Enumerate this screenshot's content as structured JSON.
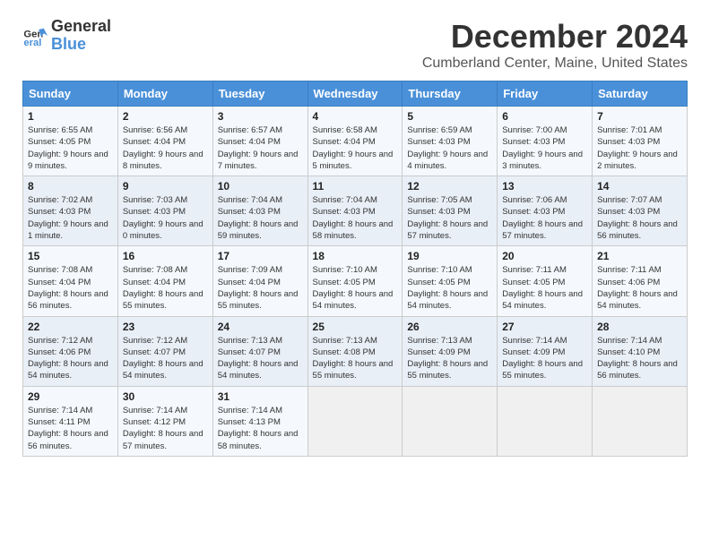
{
  "logo": {
    "line1": "General",
    "line2": "Blue"
  },
  "title": "December 2024",
  "subtitle": "Cumberland Center, Maine, United States",
  "header": {
    "days": [
      "Sunday",
      "Monday",
      "Tuesday",
      "Wednesday",
      "Thursday",
      "Friday",
      "Saturday"
    ]
  },
  "weeks": [
    [
      {
        "day": "1",
        "info": "Sunrise: 6:55 AM\nSunset: 4:05 PM\nDaylight: 9 hours and 9 minutes."
      },
      {
        "day": "2",
        "info": "Sunrise: 6:56 AM\nSunset: 4:04 PM\nDaylight: 9 hours and 8 minutes."
      },
      {
        "day": "3",
        "info": "Sunrise: 6:57 AM\nSunset: 4:04 PM\nDaylight: 9 hours and 7 minutes."
      },
      {
        "day": "4",
        "info": "Sunrise: 6:58 AM\nSunset: 4:04 PM\nDaylight: 9 hours and 5 minutes."
      },
      {
        "day": "5",
        "info": "Sunrise: 6:59 AM\nSunset: 4:03 PM\nDaylight: 9 hours and 4 minutes."
      },
      {
        "day": "6",
        "info": "Sunrise: 7:00 AM\nSunset: 4:03 PM\nDaylight: 9 hours and 3 minutes."
      },
      {
        "day": "7",
        "info": "Sunrise: 7:01 AM\nSunset: 4:03 PM\nDaylight: 9 hours and 2 minutes."
      }
    ],
    [
      {
        "day": "8",
        "info": "Sunrise: 7:02 AM\nSunset: 4:03 PM\nDaylight: 9 hours and 1 minute."
      },
      {
        "day": "9",
        "info": "Sunrise: 7:03 AM\nSunset: 4:03 PM\nDaylight: 9 hours and 0 minutes."
      },
      {
        "day": "10",
        "info": "Sunrise: 7:04 AM\nSunset: 4:03 PM\nDaylight: 8 hours and 59 minutes."
      },
      {
        "day": "11",
        "info": "Sunrise: 7:04 AM\nSunset: 4:03 PM\nDaylight: 8 hours and 58 minutes."
      },
      {
        "day": "12",
        "info": "Sunrise: 7:05 AM\nSunset: 4:03 PM\nDaylight: 8 hours and 57 minutes."
      },
      {
        "day": "13",
        "info": "Sunrise: 7:06 AM\nSunset: 4:03 PM\nDaylight: 8 hours and 57 minutes."
      },
      {
        "day": "14",
        "info": "Sunrise: 7:07 AM\nSunset: 4:03 PM\nDaylight: 8 hours and 56 minutes."
      }
    ],
    [
      {
        "day": "15",
        "info": "Sunrise: 7:08 AM\nSunset: 4:04 PM\nDaylight: 8 hours and 56 minutes."
      },
      {
        "day": "16",
        "info": "Sunrise: 7:08 AM\nSunset: 4:04 PM\nDaylight: 8 hours and 55 minutes."
      },
      {
        "day": "17",
        "info": "Sunrise: 7:09 AM\nSunset: 4:04 PM\nDaylight: 8 hours and 55 minutes."
      },
      {
        "day": "18",
        "info": "Sunrise: 7:10 AM\nSunset: 4:05 PM\nDaylight: 8 hours and 54 minutes."
      },
      {
        "day": "19",
        "info": "Sunrise: 7:10 AM\nSunset: 4:05 PM\nDaylight: 8 hours and 54 minutes."
      },
      {
        "day": "20",
        "info": "Sunrise: 7:11 AM\nSunset: 4:05 PM\nDaylight: 8 hours and 54 minutes."
      },
      {
        "day": "21",
        "info": "Sunrise: 7:11 AM\nSunset: 4:06 PM\nDaylight: 8 hours and 54 minutes."
      }
    ],
    [
      {
        "day": "22",
        "info": "Sunrise: 7:12 AM\nSunset: 4:06 PM\nDaylight: 8 hours and 54 minutes."
      },
      {
        "day": "23",
        "info": "Sunrise: 7:12 AM\nSunset: 4:07 PM\nDaylight: 8 hours and 54 minutes."
      },
      {
        "day": "24",
        "info": "Sunrise: 7:13 AM\nSunset: 4:07 PM\nDaylight: 8 hours and 54 minutes."
      },
      {
        "day": "25",
        "info": "Sunrise: 7:13 AM\nSunset: 4:08 PM\nDaylight: 8 hours and 55 minutes."
      },
      {
        "day": "26",
        "info": "Sunrise: 7:13 AM\nSunset: 4:09 PM\nDaylight: 8 hours and 55 minutes."
      },
      {
        "day": "27",
        "info": "Sunrise: 7:14 AM\nSunset: 4:09 PM\nDaylight: 8 hours and 55 minutes."
      },
      {
        "day": "28",
        "info": "Sunrise: 7:14 AM\nSunset: 4:10 PM\nDaylight: 8 hours and 56 minutes."
      }
    ],
    [
      {
        "day": "29",
        "info": "Sunrise: 7:14 AM\nSunset: 4:11 PM\nDaylight: 8 hours and 56 minutes."
      },
      {
        "day": "30",
        "info": "Sunrise: 7:14 AM\nSunset: 4:12 PM\nDaylight: 8 hours and 57 minutes."
      },
      {
        "day": "31",
        "info": "Sunrise: 7:14 AM\nSunset: 4:13 PM\nDaylight: 8 hours and 58 minutes."
      },
      null,
      null,
      null,
      null
    ]
  ]
}
